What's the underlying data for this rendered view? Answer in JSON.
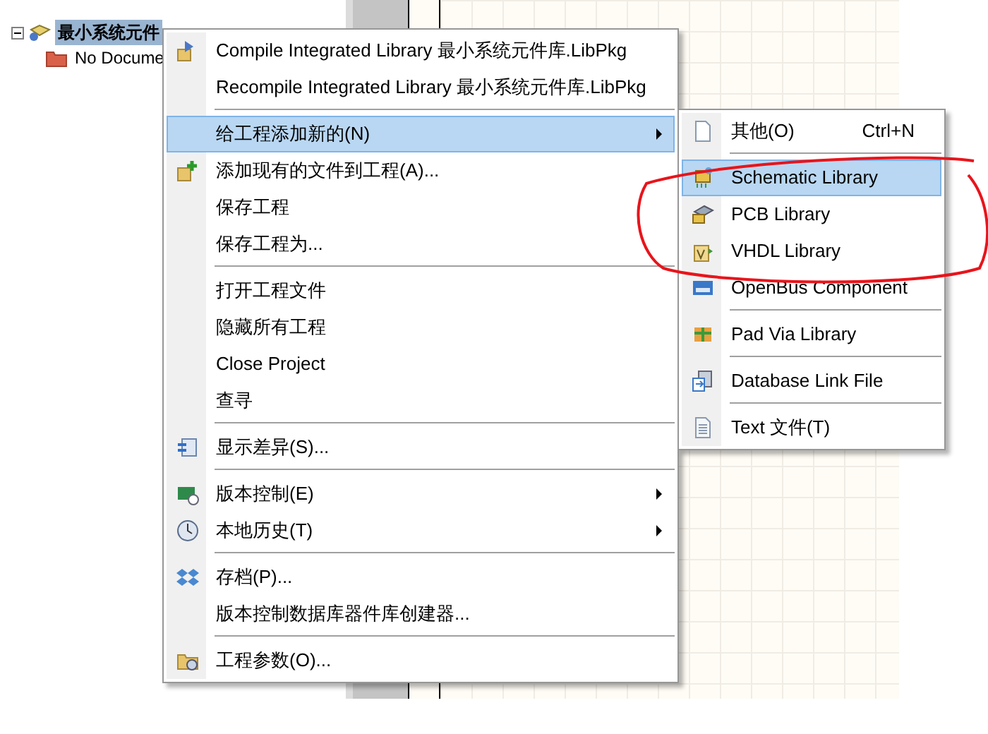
{
  "tree": {
    "items": [
      {
        "label": "最小系统元件",
        "selected": true,
        "expanded": true,
        "children": [
          {
            "label": "No Docume",
            "selected": false
          }
        ]
      }
    ]
  },
  "context_menu": {
    "items": [
      {
        "kind": "item",
        "label": "Compile Integrated Library 最小系统元件库.LibPkg",
        "selected": false,
        "submenu": false
      },
      {
        "kind": "item",
        "label": "Recompile Integrated Library 最小系统元件库.LibPkg",
        "selected": false,
        "submenu": false
      },
      {
        "kind": "separator"
      },
      {
        "kind": "item",
        "label": "给工程添加新的(N)",
        "selected": true,
        "submenu": true
      },
      {
        "kind": "item",
        "label": "添加现有的文件到工程(A)...",
        "selected": false,
        "submenu": false
      },
      {
        "kind": "item",
        "label": "保存工程",
        "selected": false,
        "submenu": false
      },
      {
        "kind": "item",
        "label": "保存工程为...",
        "selected": false,
        "submenu": false
      },
      {
        "kind": "separator"
      },
      {
        "kind": "item",
        "label": "打开工程文件",
        "selected": false,
        "submenu": false
      },
      {
        "kind": "item",
        "label": "隐藏所有工程",
        "selected": false,
        "submenu": false
      },
      {
        "kind": "item",
        "label": "Close Project",
        "selected": false,
        "submenu": false
      },
      {
        "kind": "item",
        "label": "查寻",
        "selected": false,
        "submenu": false
      },
      {
        "kind": "separator"
      },
      {
        "kind": "item",
        "label": "显示差异(S)...",
        "selected": false,
        "submenu": false
      },
      {
        "kind": "separator"
      },
      {
        "kind": "item",
        "label": "版本控制(E)",
        "selected": false,
        "submenu": true
      },
      {
        "kind": "item",
        "label": "本地历史(T)",
        "selected": false,
        "submenu": true
      },
      {
        "kind": "separator"
      },
      {
        "kind": "item",
        "label": "存档(P)...",
        "selected": false,
        "submenu": false
      },
      {
        "kind": "item",
        "label": "版本控制数据库器件库创建器...",
        "selected": false,
        "submenu": false
      },
      {
        "kind": "separator"
      },
      {
        "kind": "item",
        "label": "工程参数(O)...",
        "selected": false,
        "submenu": false
      }
    ]
  },
  "submenu": {
    "items": [
      {
        "kind": "item",
        "label": "其他(O)",
        "shortcut": "Ctrl+N",
        "selected": false
      },
      {
        "kind": "separator"
      },
      {
        "kind": "item",
        "label": "Schematic Library",
        "selected": true
      },
      {
        "kind": "item",
        "label": "PCB Library",
        "selected": false
      },
      {
        "kind": "item",
        "label": "VHDL Library",
        "selected": false
      },
      {
        "kind": "item",
        "label": "OpenBus Component",
        "selected": false
      },
      {
        "kind": "separator"
      },
      {
        "kind": "item",
        "label": "Pad Via Library",
        "selected": false
      },
      {
        "kind": "separator"
      },
      {
        "kind": "item",
        "label": "Database Link File",
        "selected": false
      },
      {
        "kind": "separator"
      },
      {
        "kind": "item",
        "label": "Text  文件(T)",
        "selected": false
      }
    ]
  }
}
